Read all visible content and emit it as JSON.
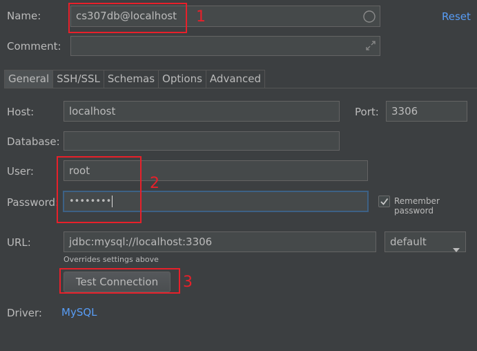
{
  "name": {
    "label": "Name:",
    "value": "cs307db@localhost"
  },
  "reset_label": "Reset",
  "comment": {
    "label": "Comment:",
    "value": ""
  },
  "tabs": [
    {
      "label": "General",
      "active": true
    },
    {
      "label": "SSH/SSL",
      "active": false
    },
    {
      "label": "Schemas",
      "active": false
    },
    {
      "label": "Options",
      "active": false
    },
    {
      "label": "Advanced",
      "active": false
    }
  ],
  "host": {
    "label": "Host:",
    "value": "localhost"
  },
  "port": {
    "label": "Port:",
    "value": "3306"
  },
  "database": {
    "label": "Database:",
    "value": ""
  },
  "user": {
    "label": "User:",
    "value": "root"
  },
  "password": {
    "label": "Password:",
    "masked": "••••••••"
  },
  "remember_password": {
    "label": "Remember password",
    "checked": true
  },
  "url": {
    "label": "URL:",
    "value": "jdbc:mysql://localhost:3306",
    "hint": "Overrides settings above"
  },
  "url_mode": {
    "selected": "default"
  },
  "test_connection_label": "Test Connection",
  "driver": {
    "label": "Driver:",
    "value": "MySQL"
  },
  "annotations": [
    "1",
    "2",
    "3"
  ],
  "colors": {
    "background": "#3c3f41",
    "field": "#45494a",
    "link": "#589df6",
    "annotation": "#e8202a",
    "focus": "#3d6185"
  },
  "icons": {
    "name_field": "circle-icon",
    "comment_field": "expand-icon",
    "select": "chevron-down-icon",
    "checkbox": "check-icon"
  }
}
